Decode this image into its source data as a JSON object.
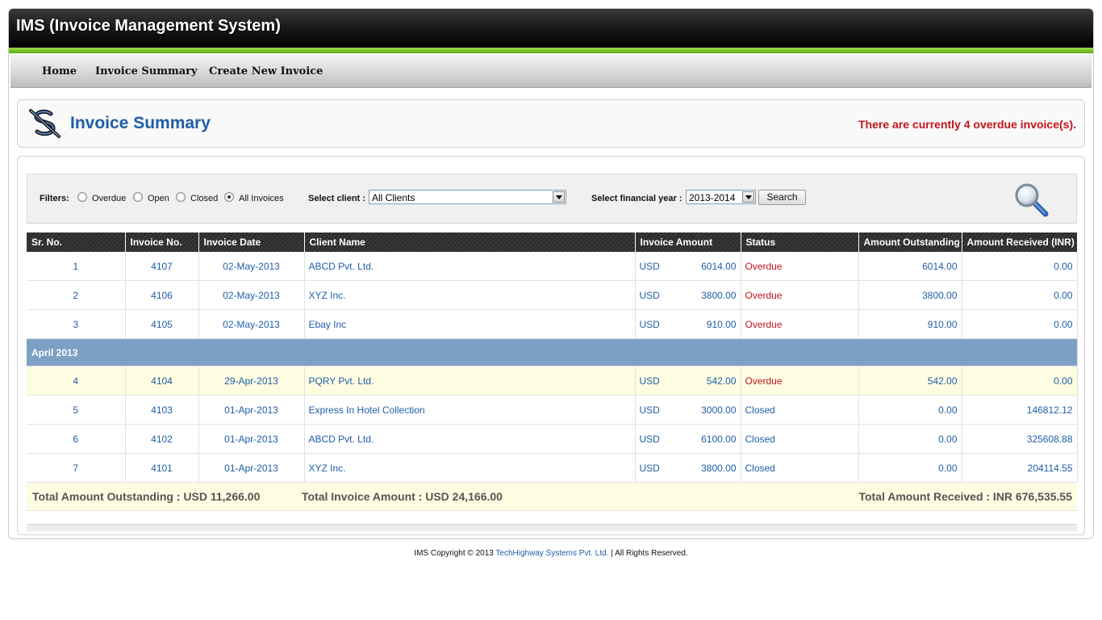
{
  "header": {
    "title": "IMS (Invoice Management System)"
  },
  "nav": {
    "items": [
      "Home",
      "Invoice Summary",
      "Create New Invoice"
    ]
  },
  "title_panel": {
    "title": "Invoice Summary",
    "overdue_message": "There are currently 4 overdue invoice(s).",
    "icon": "dollar-icon"
  },
  "filters": {
    "label": "Filters:",
    "options": [
      "Overdue",
      "Open",
      "Closed",
      "All Invoices"
    ],
    "selected": "All Invoices",
    "client_label": "Select client :",
    "client_value": "All Clients",
    "year_label": "Select financial year :",
    "year_value": "2013-2014",
    "search_label": "Search",
    "search_icon": "magnifier-icon"
  },
  "table": {
    "headers": [
      "Sr. No.",
      "Invoice No.",
      "Invoice Date",
      "Client Name",
      "Invoice Amount",
      "Status",
      "Amount Outstanding",
      "Amount Received (INR)"
    ],
    "rows_a": [
      {
        "sr": "1",
        "inv": "4107",
        "date": "02-May-2013",
        "client": "ABCD Pvt. Ltd.",
        "cur": "USD",
        "amount": "6014.00",
        "status": "Overdue",
        "outstanding": "6014.00",
        "received": "0.00"
      },
      {
        "sr": "2",
        "inv": "4106",
        "date": "02-May-2013",
        "client": "XYZ Inc.",
        "cur": "USD",
        "amount": "3800.00",
        "status": "Overdue",
        "outstanding": "3800.00",
        "received": "0.00"
      },
      {
        "sr": "3",
        "inv": "4105",
        "date": "02-May-2013",
        "client": "Ebay Inc",
        "cur": "USD",
        "amount": "910.00",
        "status": "Overdue",
        "outstanding": "910.00",
        "received": "0.00"
      }
    ],
    "group_label": "April 2013",
    "rows_b": [
      {
        "sr": "4",
        "inv": "4104",
        "date": "29-Apr-2013",
        "client": "PQRY Pvt. Ltd.",
        "cur": "USD",
        "amount": "542.00",
        "status": "Overdue",
        "outstanding": "542.00",
        "received": "0.00"
      },
      {
        "sr": "5",
        "inv": "4103",
        "date": "01-Apr-2013",
        "client": "Express In Hotel Collection",
        "cur": "USD",
        "amount": "3000.00",
        "status": "Closed",
        "outstanding": "0.00",
        "received": "146812.12"
      },
      {
        "sr": "6",
        "inv": "4102",
        "date": "01-Apr-2013",
        "client": "ABCD Pvt. Ltd.",
        "cur": "USD",
        "amount": "6100.00",
        "status": "Closed",
        "outstanding": "0.00",
        "received": "325608.88"
      },
      {
        "sr": "7",
        "inv": "4101",
        "date": "01-Apr-2013",
        "client": "XYZ Inc.",
        "cur": "USD",
        "amount": "3800.00",
        "status": "Closed",
        "outstanding": "0.00",
        "received": "204114.55"
      }
    ],
    "highlighted_row": "4104"
  },
  "totals": {
    "outstanding": "Total Amount Outstanding : USD 11,266.00",
    "invoice": "Total Invoice Amount : USD 24,166.00",
    "received": "Total Amount Received : INR 676,535.55"
  },
  "footer": {
    "prefix": "IMS Copyright © 2013 ",
    "company": "TechHighway Systems Pvt. Ltd.",
    "suffix": " | All Rights Reserved."
  },
  "colors": {
    "accent_green": "#6dbb1f",
    "link_blue": "#1f5ea8",
    "overdue_red": "#c4141a",
    "group_row": "#7ea0c4",
    "highlight_row": "#fefde2"
  }
}
